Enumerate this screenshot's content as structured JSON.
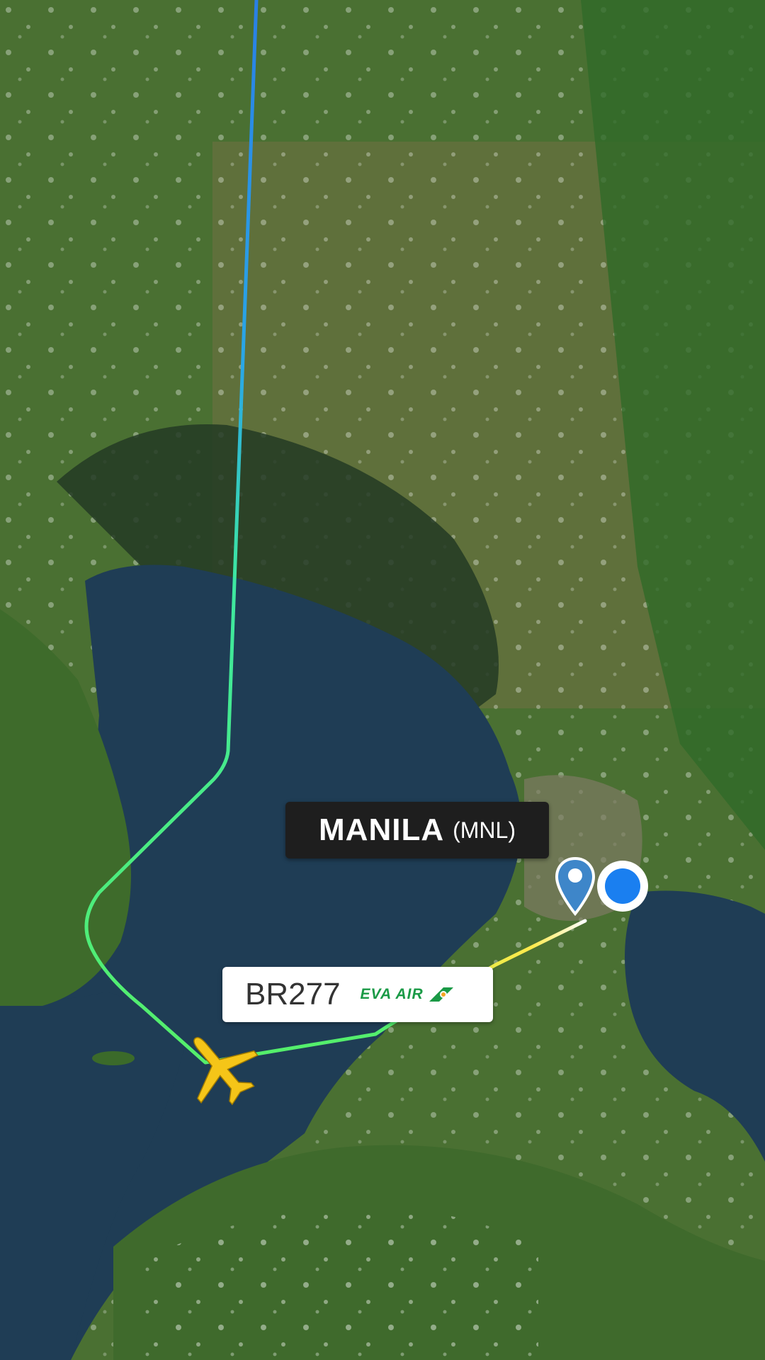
{
  "map": {
    "airport_label": {
      "name": "MANILA",
      "code": "(MNL)"
    },
    "flight_label": {
      "callsign": "BR277",
      "airline": "EVA AIR"
    },
    "icons": {
      "destination_pin": "map-pin-icon",
      "user_location": "location-dot-icon",
      "aircraft": "airplane-icon",
      "airline_logo": "eva-air-logo"
    },
    "colors": {
      "track_start": "#2a7fe6",
      "track_mid": "#3ee8a0",
      "track_end": "#ffe94d",
      "aircraft": "#f5c518",
      "pin": "#3e86c9",
      "location_dot": "#1a7ff0",
      "airline_green": "#1a9a46"
    }
  }
}
